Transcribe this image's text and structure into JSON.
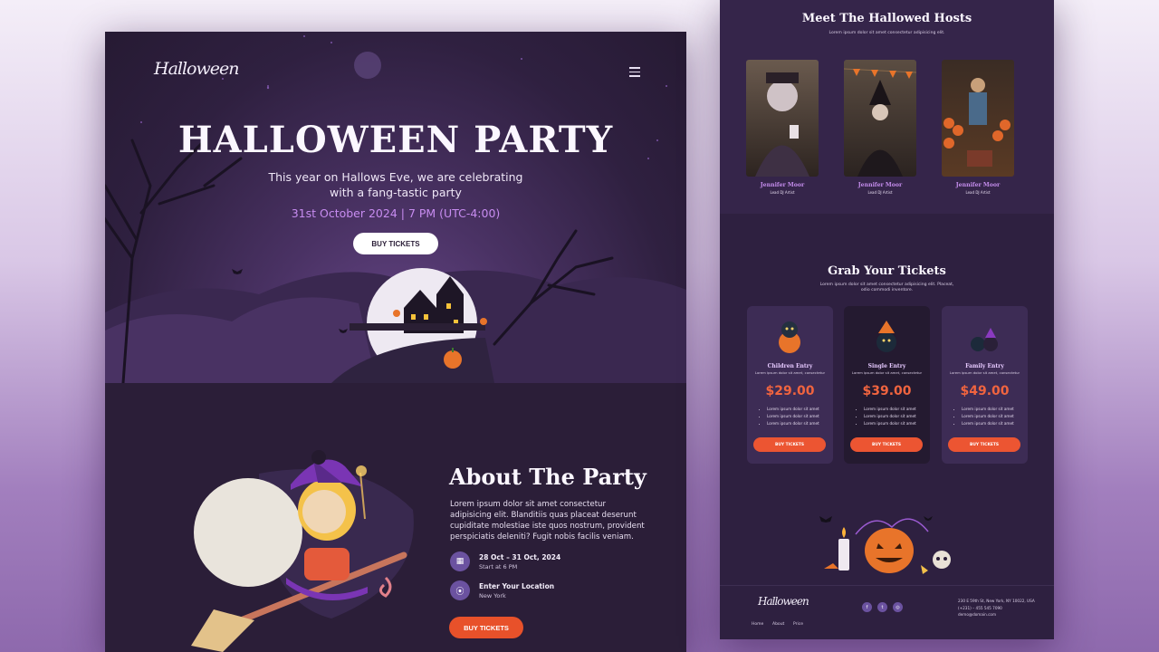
{
  "left_page": {
    "logo": "Halloween",
    "hero": {
      "title": "HALLOWEEN PARTY",
      "subtitle": "This year on Hallows Eve, we are celebrating with a fang-tastic party",
      "date": "31st October 2024 | 7 PM (UTC-4:00)",
      "button": "BUY TICKETS"
    },
    "about": {
      "title": "About The Party",
      "text": "Lorem ipsum dolor sit amet consectetur adipisicing elit. Blanditiis quas placeat deserunt cupiditate molestiae iste quos nostrum, provident perspiciatis deleniti? Fugit nobis facilis veniam.",
      "date_title": "28 Oct – 31 Oct, 2024",
      "date_sub": "Start at 6 PM",
      "location_title": "Enter Your Location",
      "location_sub": "New York",
      "button": "BUY TICKETS"
    }
  },
  "right_page": {
    "hosts": {
      "title": "Meet The Hallowed Hosts",
      "subtitle": "Lorem ipsum dolor sit amet consectetur adipisicing elit.",
      "items": [
        {
          "name": "Jennifer Moor",
          "role": "Lead DJ Artist"
        },
        {
          "name": "Jennifer Moor",
          "role": "Lead DJ Artist"
        },
        {
          "name": "Jennifer Moor",
          "role": "Lead DJ Artist"
        }
      ]
    },
    "tickets": {
      "title": "Grab Your Tickets",
      "subtitle": "Lorem ipsum dolor sit amet consectetur adipisicing elit. Placeat, odio commodi inventore.",
      "cards": [
        {
          "name": "Children Entry",
          "desc": "Lorem ipsum dolor sit amet, consectetur",
          "price": "$29.00",
          "features": [
            "Lorem ipsum dolor sit amet",
            "Lorem ipsum dolor sit amet",
            "Lorem ipsum dolor sit amet"
          ],
          "button": "BUY TICKETS"
        },
        {
          "name": "Single Entry",
          "desc": "Lorem ipsum dolor sit amet, consectetur",
          "price": "$39.00",
          "features": [
            "Lorem ipsum dolor sit amet",
            "Lorem ipsum dolor sit amet",
            "Lorem ipsum dolor sit amet"
          ],
          "button": "BUY TICKETS"
        },
        {
          "name": "Family Entry",
          "desc": "Lorem ipsum dolor sit amet, consectetur",
          "price": "$49.00",
          "features": [
            "Lorem ipsum dolor sit amet",
            "Lorem ipsum dolor sit amet",
            "Lorem ipsum dolor sit amet"
          ],
          "button": "BUY TICKETS"
        }
      ]
    },
    "footer": {
      "logo": "Halloween",
      "nav": [
        "Home",
        "About",
        "Price"
      ],
      "address": "230 E 59th St, New York, NY 10022, USA",
      "phone": "(+231) – 455 545 7090",
      "email": "demo@domain.com",
      "social": [
        "facebook-icon",
        "twitter-icon",
        "instagram-icon"
      ]
    }
  },
  "colors": {
    "accent": "#c58ded",
    "orange": "#e8512a",
    "bg_dark": "#2a1d37",
    "purple_icon": "#6b52a0"
  }
}
